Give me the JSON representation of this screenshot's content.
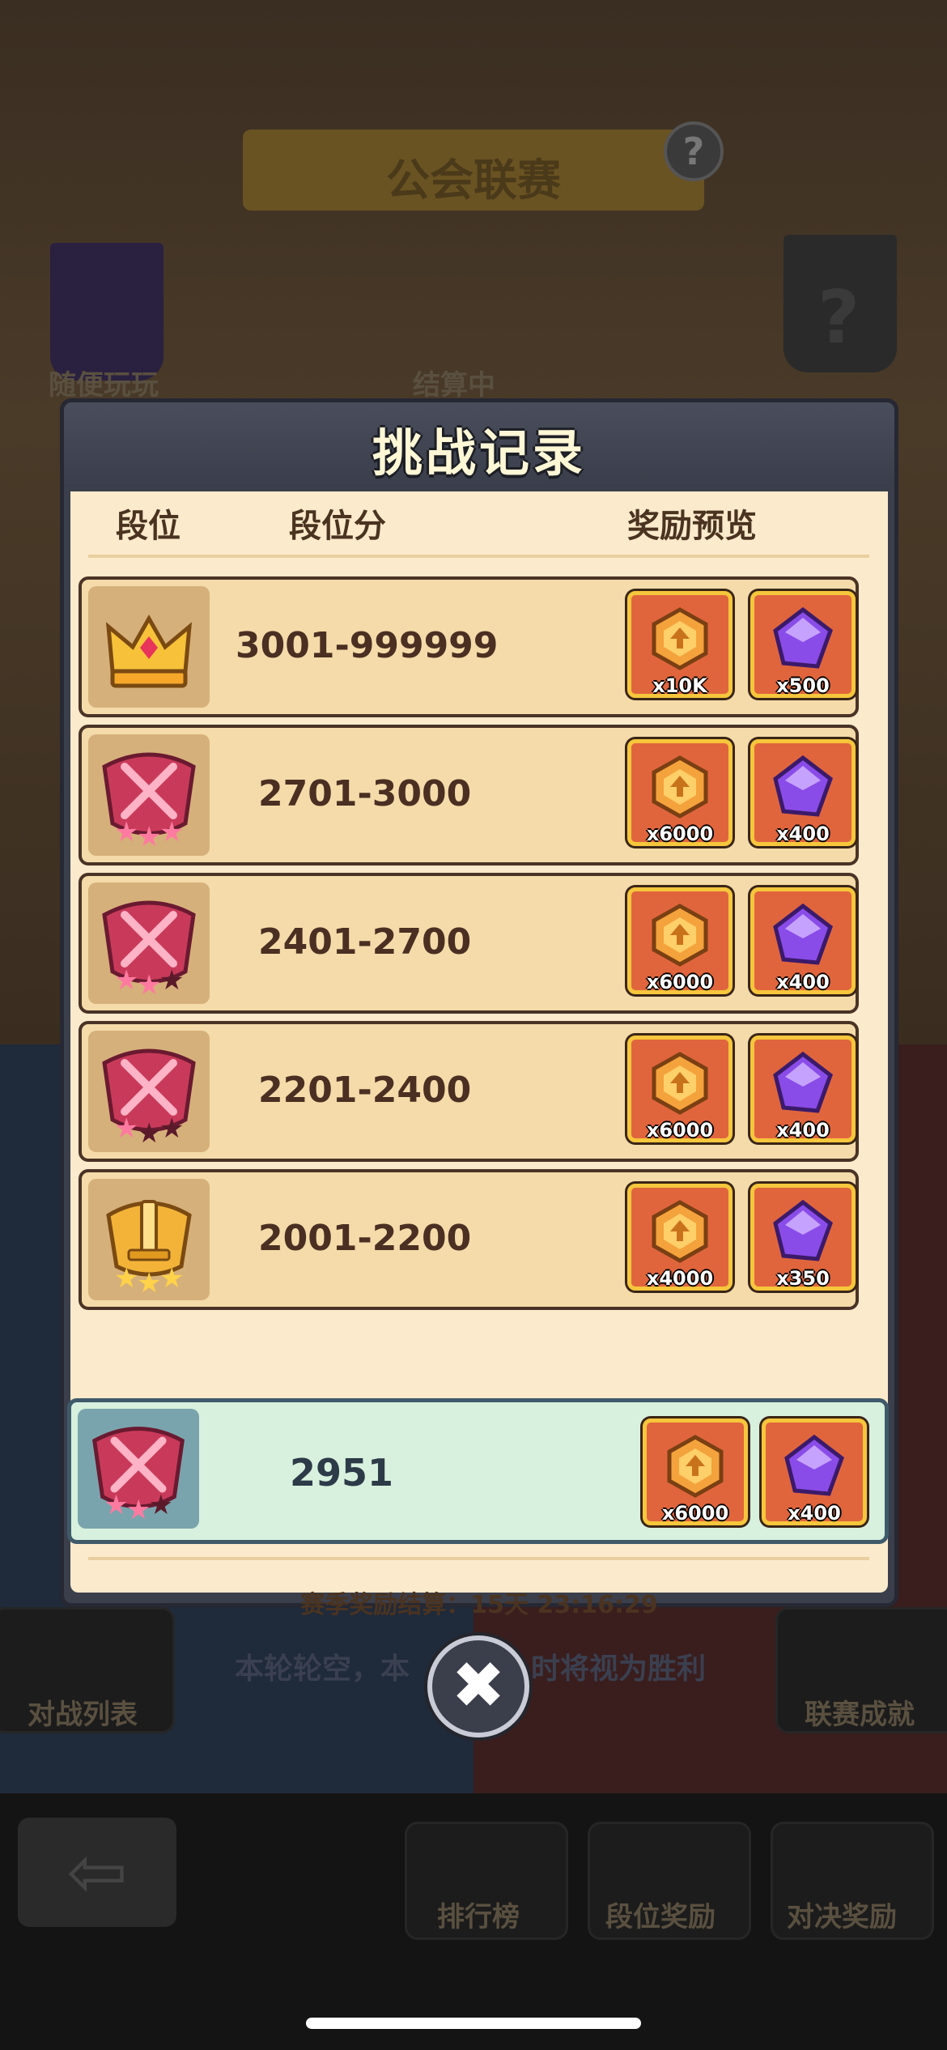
{
  "background": {
    "title": "公会联赛",
    "help": "?",
    "left_banner_label": "随便玩玩",
    "right_banner_label": "?",
    "settling_label": "结算中",
    "hint": "本轮轮空，本",
    "hint_tail": "时将视为胜利",
    "left_tile_label": "对战列表",
    "right_tile_label": "联赛成就",
    "bottom_nav": [
      "排行榜",
      "段位奖励",
      "对决奖励"
    ]
  },
  "dialog": {
    "title": "挑战记录",
    "columns": {
      "rank": "段位",
      "score": "段位分",
      "rewards": "奖励预览"
    },
    "rows": [
      {
        "score": "3001-999999",
        "badge": "crown-icon",
        "coin_qty": "x10K",
        "gem_qty": "x500"
      },
      {
        "score": "2701-3000",
        "badge": "red-swords-3-stars-icon",
        "coin_qty": "x6000",
        "gem_qty": "x400"
      },
      {
        "score": "2401-2700",
        "badge": "red-swords-2-stars-icon",
        "coin_qty": "x6000",
        "gem_qty": "x400"
      },
      {
        "score": "2201-2400",
        "badge": "red-swords-1-star-icon",
        "coin_qty": "x6000",
        "gem_qty": "x400"
      },
      {
        "score": "2001-2200",
        "badge": "gold-sword-3-stars-icon",
        "coin_qty": "x4000",
        "gem_qty": "x350"
      }
    ],
    "current": {
      "score": "2951",
      "badge": "red-swords-2-stars-icon",
      "coin_qty": "x6000",
      "gem_qty": "x400"
    },
    "season_settlement": "赛季奖励结算：15天 23:16:29"
  },
  "close_symbol": "✖",
  "colors": {
    "panel": "#fbeacb",
    "row": "#f4dba9",
    "current_row": "#d7f1de",
    "reward_tile": "#e0653d",
    "reward_border": "#f6c63c"
  }
}
